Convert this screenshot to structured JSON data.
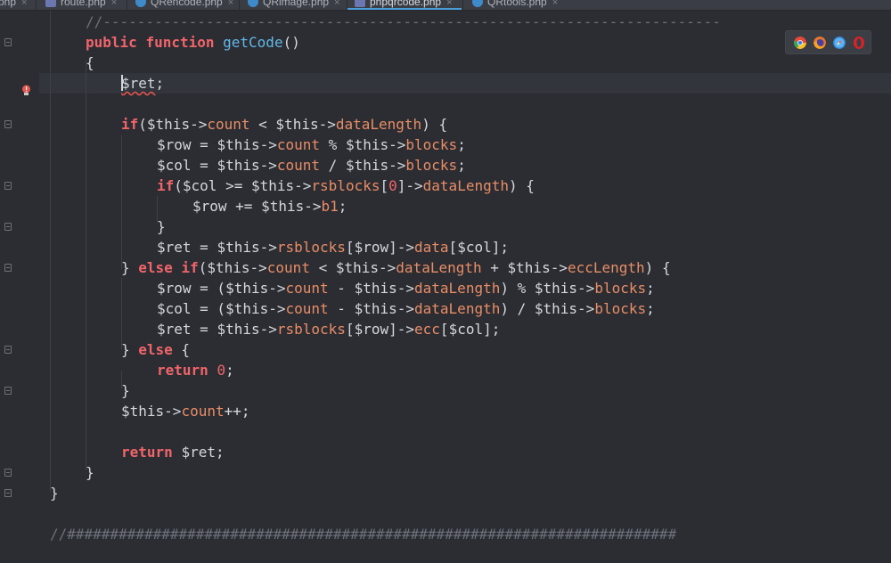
{
  "tabs": [
    {
      "label": "php",
      "icon": "php-file-icon",
      "active": false
    },
    {
      "label": "route.php",
      "icon": "php-file-icon",
      "active": false
    },
    {
      "label": "QRencode.php",
      "icon": "php-class-icon",
      "active": false
    },
    {
      "label": "QRimage.php",
      "icon": "php-class-icon",
      "active": false
    },
    {
      "label": "phpqrcode.php",
      "icon": "php-file-icon",
      "active": true
    },
    {
      "label": "QRtools.php",
      "icon": "php-class-icon",
      "active": false
    }
  ],
  "tab_close_glyph": "×",
  "code": {
    "separator_comment": "//------------------------------------------------------------------------",
    "hash_comment": "//#######################################################################",
    "kw_public": "public",
    "kw_function": "function",
    "fn_name": "getCode",
    "kw_if": "if",
    "kw_else": "else",
    "kw_return": "return",
    "var_ret": "$ret",
    "var_this": "$this",
    "var_row": "$row",
    "var_col": "$col",
    "prop_count": "count",
    "prop_dataLength": "dataLength",
    "prop_blocks": "blocks",
    "prop_rsblocks": "rsblocks",
    "prop_b1": "b1",
    "prop_data": "data",
    "prop_ecc": "ecc",
    "prop_eccLength": "eccLength",
    "num_zero": "0"
  },
  "browser_icons": [
    {
      "name": "chrome-icon",
      "color": "#e7493b"
    },
    {
      "name": "firefox-icon",
      "color": "#e8772e"
    },
    {
      "name": "safari-icon",
      "color": "#2f8ee0"
    },
    {
      "name": "opera-icon",
      "color": "#d8232a"
    }
  ],
  "colors": {
    "background": "#2b2d33",
    "keyword": "#f0656a",
    "function": "#62b8e8",
    "property": "#e98d66",
    "comment": "#6b7079",
    "text": "#d4d7dc"
  }
}
